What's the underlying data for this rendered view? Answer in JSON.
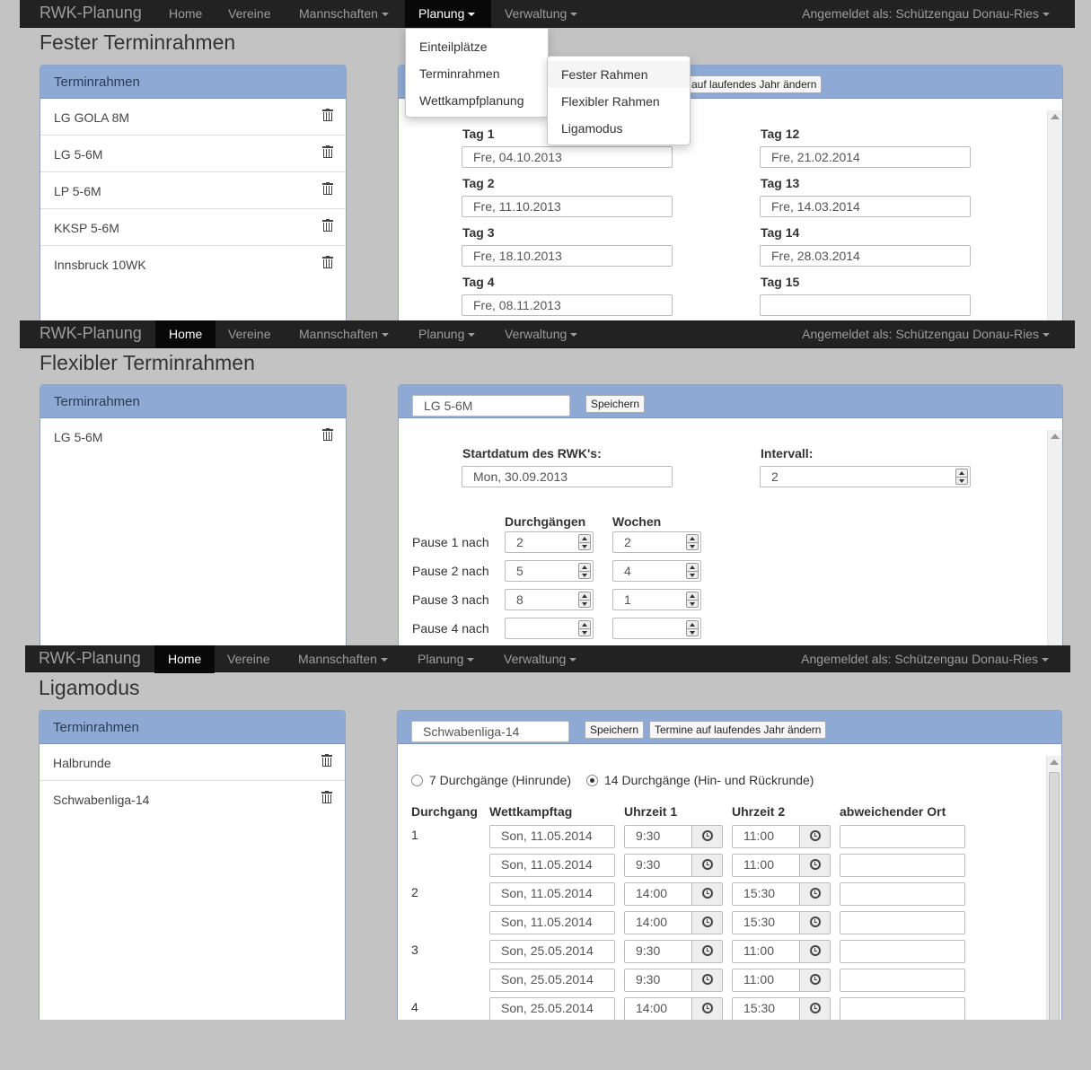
{
  "nav": {
    "brand": "RWK-Planung",
    "home": "Home",
    "vereine": "Vereine",
    "mannschaften": "Mannschaften",
    "planung": "Planung",
    "verwaltung": "Verwaltung",
    "user": "Angemeldet als: Schützengau Donau-Ries"
  },
  "shot1": {
    "title": "Fester Terminrahmen",
    "panel_title": "Terminrahmen",
    "items": [
      "LG GOLA 8M",
      "LG 5-6M",
      "LP 5-6M",
      "KKSP 5-6M",
      "Innsbruck 10WK"
    ],
    "header_button_partial": "e auf laufendes Jahr ändern",
    "planung_menu": [
      "Einteilplätze",
      "Terminrahmen",
      "Wettkampfplanung"
    ],
    "terminrahmen_menu": [
      "Fester Rahmen",
      "Flexibler Rahmen",
      "Ligamodus"
    ],
    "days_left": [
      {
        "label": "Tag 1",
        "value": "Fre, 04.10.2013"
      },
      {
        "label": "Tag 2",
        "value": "Fre, 11.10.2013"
      },
      {
        "label": "Tag 3",
        "value": "Fre, 18.10.2013"
      },
      {
        "label": "Tag 4",
        "value": "Fre, 08.11.2013"
      }
    ],
    "days_right": [
      {
        "label": "Tag 12",
        "value": "Fre, 21.02.2014"
      },
      {
        "label": "Tag 13",
        "value": "Fre, 14.03.2014"
      },
      {
        "label": "Tag 14",
        "value": "Fre, 28.03.2014"
      },
      {
        "label": "Tag 15",
        "value": ""
      }
    ]
  },
  "shot2": {
    "title": "Flexibler Terminrahmen",
    "panel_title": "Terminrahmen",
    "items": [
      "LG 5-6M"
    ],
    "name_value": "LG 5-6M",
    "save": "Speichern",
    "start_label": "Startdatum des RWK's:",
    "start_value": "Mon, 30.09.2013",
    "interval_label": "Intervall:",
    "interval_value": "2",
    "col_durchgaenge": "Durchgängen",
    "col_wochen": "Wochen",
    "pauses": [
      {
        "label": "Pause 1 nach",
        "durchgaenge": "2",
        "wochen": "2"
      },
      {
        "label": "Pause 2 nach",
        "durchgaenge": "5",
        "wochen": "4"
      },
      {
        "label": "Pause 3 nach",
        "durchgaenge": "8",
        "wochen": "1"
      },
      {
        "label": "Pause 4 nach",
        "durchgaenge": "",
        "wochen": ""
      }
    ]
  },
  "shot3": {
    "title": "Ligamodus",
    "panel_title": "Terminrahmen",
    "items": [
      "Halbrunde",
      "Schwabenliga-14"
    ],
    "name_value": "Schwabenliga-14",
    "save": "Speichern",
    "change_year": "Termine auf laufendes Jahr ändern",
    "radio1": "7 Durchgänge (Hinrunde)",
    "radio2": "14 Durchgänge (Hin- und Rückrunde)",
    "headers": {
      "durchgang": "Durchgang",
      "tag": "Wettkampftag",
      "zeit1": "Uhrzeit 1",
      "zeit2": "Uhrzeit 2",
      "ort": "abweichender Ort"
    },
    "rows": [
      {
        "d": "1",
        "tag": "Son, 11.05.2014",
        "z1": "9:30",
        "z2": "11:00",
        "ort": ""
      },
      {
        "d": "",
        "tag": "Son, 11.05.2014",
        "z1": "9:30",
        "z2": "11:00",
        "ort": ""
      },
      {
        "d": "2",
        "tag": "Son, 11.05.2014",
        "z1": "14:00",
        "z2": "15:30",
        "ort": ""
      },
      {
        "d": "",
        "tag": "Son, 11.05.2014",
        "z1": "14:00",
        "z2": "15:30",
        "ort": ""
      },
      {
        "d": "3",
        "tag": "Son, 25.05.2014",
        "z1": "9:30",
        "z2": "11:00",
        "ort": ""
      },
      {
        "d": "",
        "tag": "Son, 25.05.2014",
        "z1": "9:30",
        "z2": "11:00",
        "ort": ""
      },
      {
        "d": "4",
        "tag": "Son, 25.05.2014",
        "z1": "14:00",
        "z2": "15:30",
        "ort": ""
      }
    ]
  }
}
